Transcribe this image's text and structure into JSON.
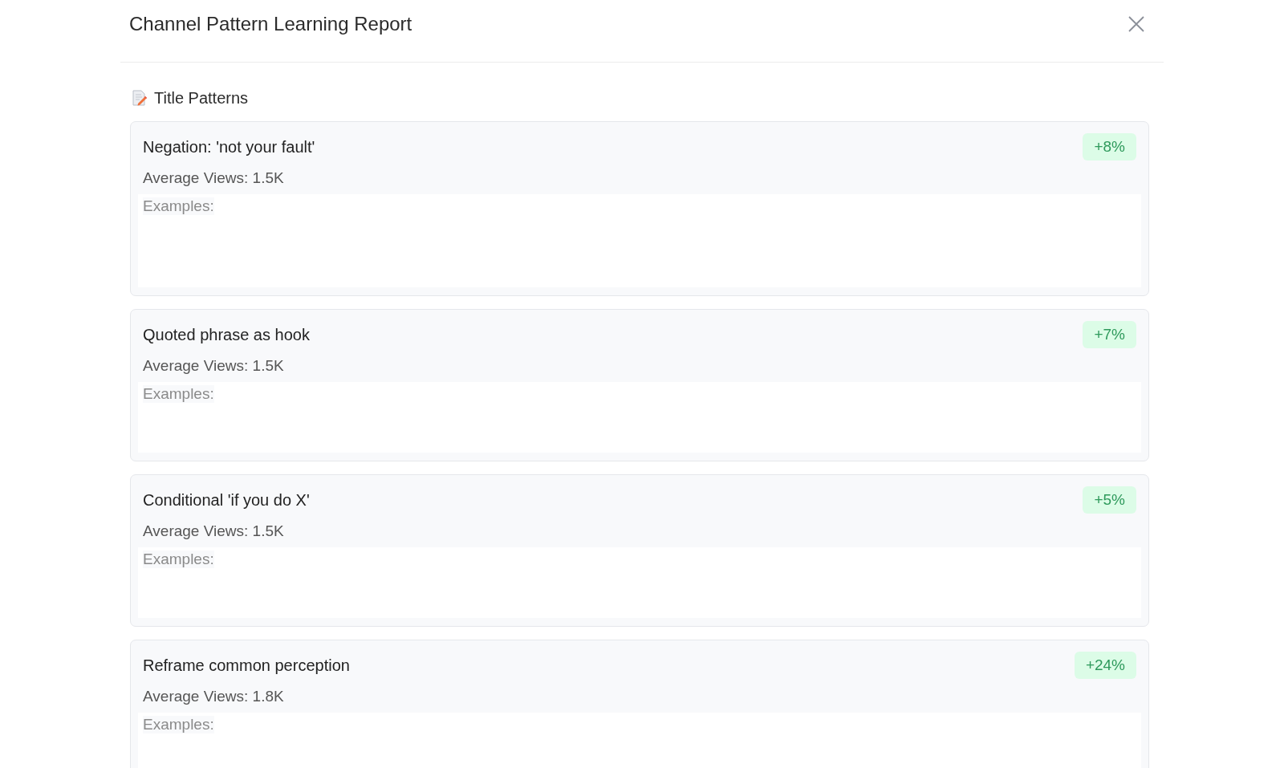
{
  "dialog": {
    "title": "Channel Pattern Learning Report"
  },
  "section": {
    "title": "Title Patterns"
  },
  "patterns": [
    {
      "name": "Negation: 'not your fault'",
      "change": "+8%",
      "average_views": "Average Views: 1.5K",
      "examples_label": "Examples:"
    },
    {
      "name": "Quoted phrase as hook",
      "change": "+7%",
      "average_views": "Average Views: 1.5K",
      "examples_label": "Examples:"
    },
    {
      "name": "Conditional 'if you do X'",
      "change": "+5%",
      "average_views": "Average Views: 1.5K",
      "examples_label": "Examples:"
    },
    {
      "name": "Reframe common perception",
      "change": "+24%",
      "average_views": "Average Views: 1.8K",
      "examples_label": "Examples:"
    }
  ]
}
